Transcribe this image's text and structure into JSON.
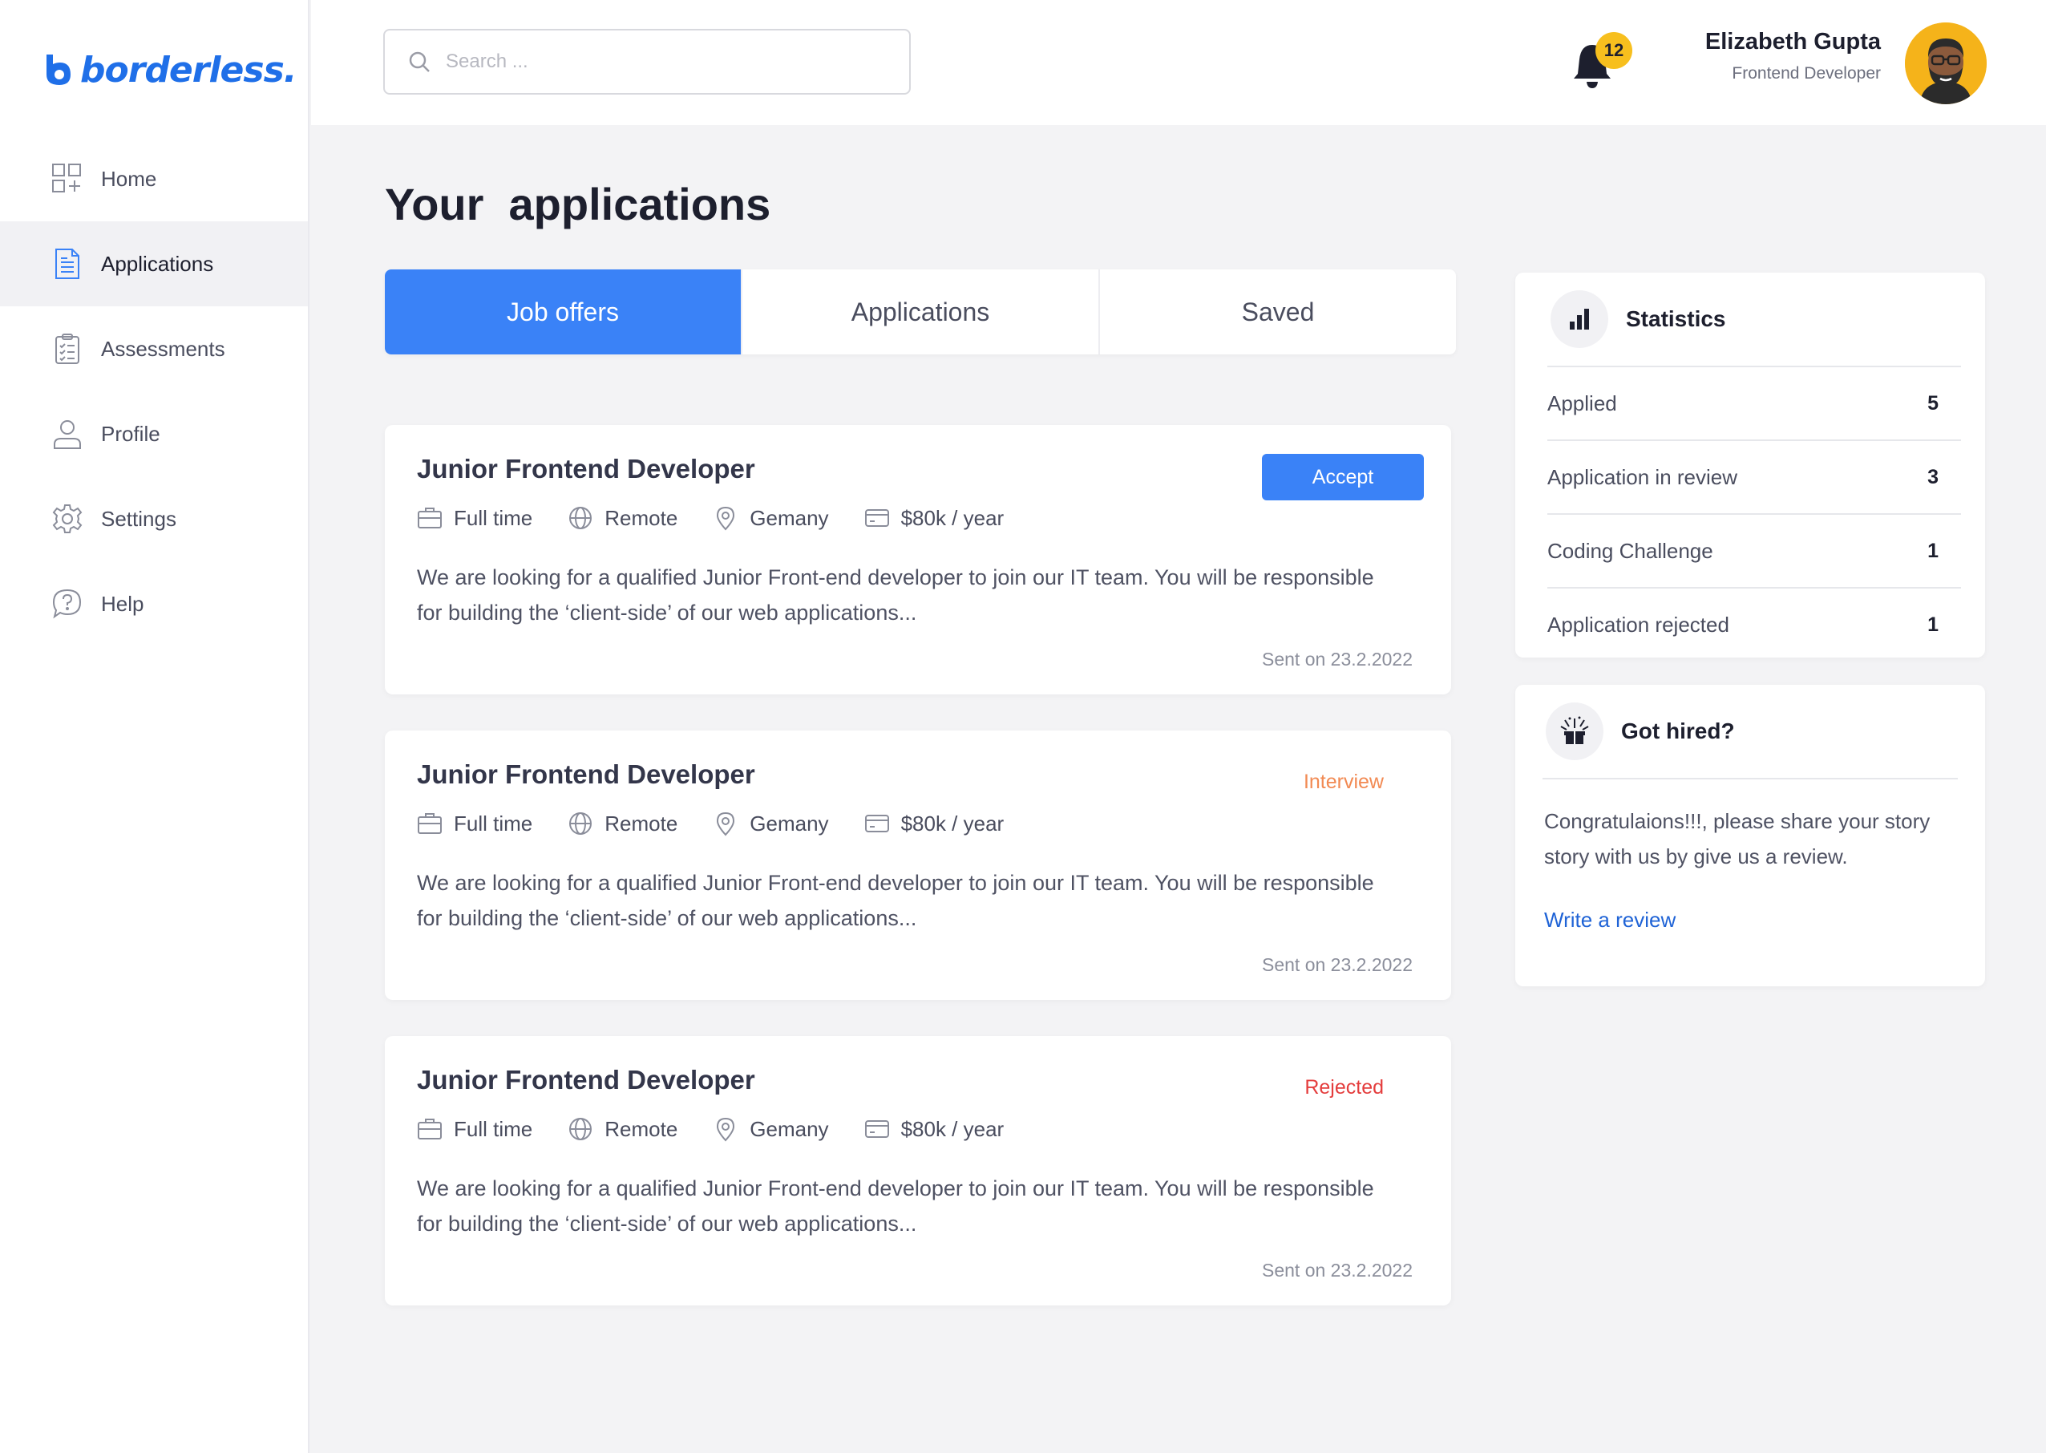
{
  "brand": {
    "name": "borderless.",
    "color": "#1f6fe8"
  },
  "sidebar": {
    "items": [
      {
        "label": "Home",
        "icon": "grid-plus-icon",
        "active": false
      },
      {
        "label": "Applications",
        "icon": "document-icon",
        "active": true
      },
      {
        "label": "Assessments",
        "icon": "clipboard-check-icon",
        "active": false
      },
      {
        "label": "Profile",
        "icon": "user-icon",
        "active": false
      },
      {
        "label": "Settings",
        "icon": "gear-icon",
        "active": false
      },
      {
        "label": "Help",
        "icon": "help-chat-icon",
        "active": false
      }
    ]
  },
  "header": {
    "search_placeholder": "Search ...",
    "notification_count": "12",
    "user_name": "Elizabeth Gupta",
    "user_role": "Frontend Developer"
  },
  "main": {
    "title": "Your  applications",
    "tabs": [
      {
        "label": "Job offers",
        "active": true
      },
      {
        "label": "Applications",
        "active": false
      },
      {
        "label": "Saved",
        "active": false
      }
    ],
    "jobs": [
      {
        "title": "Junior Frontend Developer",
        "type": "Full time",
        "location_type": "Remote",
        "country": "Gemany",
        "salary": "$80k / year",
        "description": "We are looking for a qualified Junior Front-end developer to join our IT team. You will be responsible for building the ‘client-side’ of our web applications...",
        "sent": "Sent on 23.2.2022",
        "action_label": "Accept"
      },
      {
        "title": "Junior Frontend Developer",
        "type": "Full time",
        "location_type": "Remote",
        "country": "Gemany",
        "salary": "$80k / year",
        "description": "We are looking for a qualified Junior Front-end developer to join our IT team. You will be responsible for building the ‘client-side’ of our web applications...",
        "sent": "Sent on 23.2.2022",
        "status": "Interview"
      },
      {
        "title": "Junior Frontend Developer",
        "type": "Full time",
        "location_type": "Remote",
        "country": "Gemany",
        "salary": "$80k / year",
        "description": "We are looking for a qualified Junior Front-end developer to join our IT team. You will be responsible for building the ‘client-side’ of our web applications...",
        "sent": "Sent on 23.2.2022",
        "status": "Rejected"
      }
    ]
  },
  "statistics": {
    "title": "Statistics",
    "rows": [
      {
        "label": "Applied",
        "value": "5"
      },
      {
        "label": "Application in review",
        "value": "3"
      },
      {
        "label": "Coding Challenge",
        "value": "1"
      },
      {
        "label": "Application rejected",
        "value": "1"
      }
    ]
  },
  "hired": {
    "title": "Got hired?",
    "text": "Congratulaions!!!, please share your story story with us by give us a review.",
    "link_label": "Write a review"
  },
  "colors": {
    "accent": "#3a82f7",
    "interview": "#f28a53",
    "rejected": "#e43d3d",
    "badge": "#f7bf1e",
    "link": "#1f63d6"
  }
}
